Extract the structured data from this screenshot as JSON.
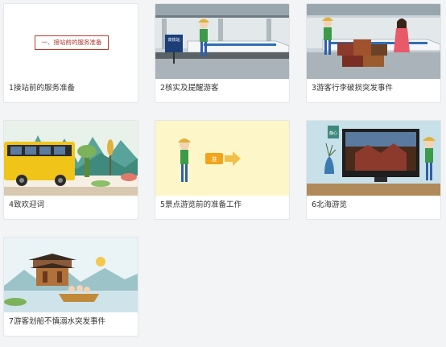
{
  "cards": [
    {
      "caption": "1接站前的服务准备",
      "title": "一、接站前的服务准备"
    },
    {
      "caption": "2核实及提醒游客",
      "sign": "高铁站"
    },
    {
      "caption": "3游客行李破损突发事件"
    },
    {
      "caption": "4致欢迎词"
    },
    {
      "caption": "5景点游览前的准备工作",
      "badge": "准"
    },
    {
      "caption": "6北海游览",
      "tv_sign": "静心"
    },
    {
      "caption": "7游客划船不慎溺水突发事件"
    }
  ],
  "colors": {
    "background": "#f3f4f6",
    "card": "#ffffff",
    "title_red": "#b03a2e"
  }
}
